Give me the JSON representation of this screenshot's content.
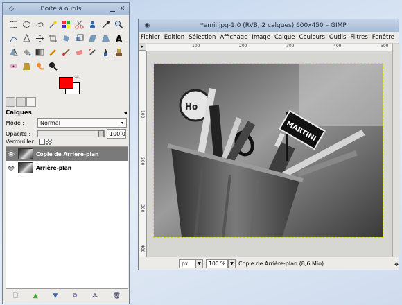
{
  "toolbox": {
    "title": "Boîte à outils",
    "tools": [
      "rect-select",
      "ellipse-select",
      "lasso",
      "fuzzy-select",
      "color-select",
      "scissors",
      "foreground-select",
      "color-picker",
      "zoom",
      "paths",
      "measure",
      "move",
      "crop",
      "rotate",
      "scale",
      "shear",
      "perspective",
      "text",
      "flip",
      "bucket-fill",
      "blend",
      "pencil",
      "paintbrush",
      "eraser",
      "airbrush",
      "ink",
      "clone",
      "heal",
      "perspective-clone",
      "smudge",
      "dodge-burn"
    ],
    "fg_color": "#ff0000",
    "bg_color": "#ffffff"
  },
  "layers_panel": {
    "title": "Calques",
    "mode_label": "Mode :",
    "mode_value": "Normal",
    "opacity_label": "Opacité :",
    "opacity_value": "100,0",
    "lock_label": "Verrouiller :",
    "layers": [
      {
        "name": "Copie de Arrière-plan",
        "selected": true
      },
      {
        "name": "Arrière-plan",
        "selected": false
      }
    ]
  },
  "image_window": {
    "title": "*emii.jpg-1.0 (RVB, 2 calques) 600x450 – GIMP",
    "menus": [
      "Fichier",
      "Édition",
      "Sélection",
      "Affichage",
      "Image",
      "Calque",
      "Couleurs",
      "Outils",
      "Filtres",
      "Fenêtre"
    ],
    "ruler_h": [
      "100",
      "200",
      "300",
      "400",
      "500"
    ],
    "ruler_v": [
      "100",
      "200",
      "300",
      "400"
    ],
    "photo_labels": {
      "martini": "MARTINI",
      "hot": "Ho"
    },
    "unit": "px",
    "zoom": "100 %",
    "status": "Copie de Arrière-plan (8,6 Mio)"
  }
}
